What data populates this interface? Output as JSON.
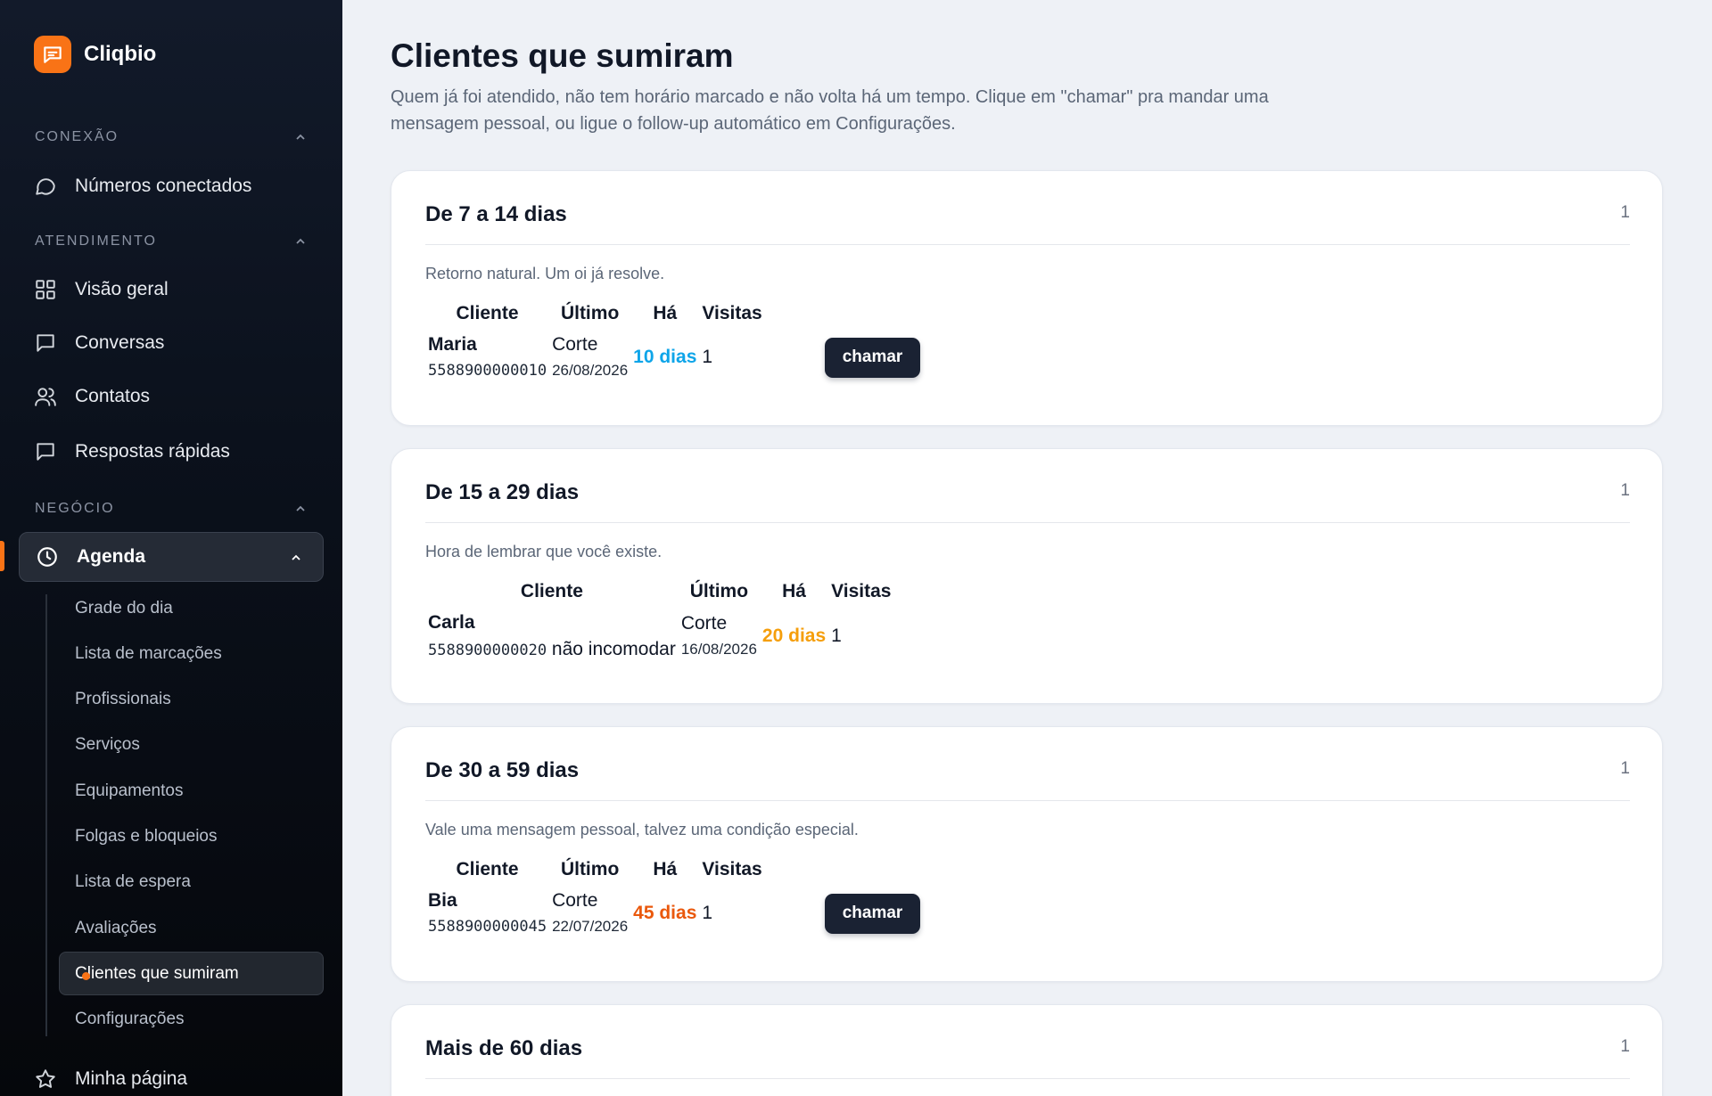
{
  "brand": {
    "name": "Cliqbio"
  },
  "sidebar": {
    "sections": [
      {
        "label": "CONEXÃO"
      },
      {
        "label": "ATENDIMENTO"
      },
      {
        "label": "NEGÓCIO"
      }
    ],
    "conexao_items": [
      {
        "label": "Números conectados",
        "icon": "chat-bubble-icon"
      }
    ],
    "atendimento_items": [
      {
        "label": "Visão geral",
        "icon": "grid-icon"
      },
      {
        "label": "Conversas",
        "icon": "message-square-icon"
      },
      {
        "label": "Contatos",
        "icon": "users-icon"
      },
      {
        "label": "Respostas rápidas",
        "icon": "message-square-icon"
      }
    ],
    "agenda": {
      "label": "Agenda",
      "icon": "clock-icon"
    },
    "agenda_sub": [
      {
        "label": "Grade do dia"
      },
      {
        "label": "Lista de marcações"
      },
      {
        "label": "Profissionais"
      },
      {
        "label": "Serviços"
      },
      {
        "label": "Equipamentos"
      },
      {
        "label": "Folgas e bloqueios"
      },
      {
        "label": "Lista de espera"
      },
      {
        "label": "Avaliações"
      },
      {
        "label": "Clientes que sumiram"
      },
      {
        "label": "Configurações"
      }
    ],
    "minha_pagina": {
      "label": "Minha página",
      "icon": "star-icon"
    }
  },
  "page": {
    "title": "Clientes que sumiram",
    "description": "Quem já foi atendido, não tem horário marcado e não volta há um tempo. Clique em \"chamar\" pra mandar uma mensagem pessoal, ou ligue o follow-up automático em Configurações."
  },
  "table_headers": {
    "cliente": "Cliente",
    "ultimo": "Último",
    "ha": "Há",
    "visitas": "Visitas"
  },
  "groups": [
    {
      "title": "De 7 a 14 dias",
      "count": "1",
      "hint": "Retorno natural. Um oi já resolve.",
      "row": {
        "name": "Maria",
        "phone": "5588900000010",
        "note": "",
        "service": "Corte",
        "date": "26/08/2026",
        "days": "10 dias",
        "days_color": "#0ea5e9",
        "visits": "1",
        "action": "chamar"
      }
    },
    {
      "title": "De 15 a 29 dias",
      "count": "1",
      "hint": "Hora de lembrar que você existe.",
      "row": {
        "name": "Carla",
        "phone": "5588900000020",
        "note": "não incomodar",
        "service": "Corte",
        "date": "16/08/2026",
        "days": "20 dias",
        "days_color": "#f59e0b",
        "visits": "1",
        "action": ""
      }
    },
    {
      "title": "De 30 a 59 dias",
      "count": "1",
      "hint": "Vale uma mensagem pessoal, talvez uma condição especial.",
      "row": {
        "name": "Bia",
        "phone": "5588900000045",
        "note": "",
        "service": "Corte",
        "date": "22/07/2026",
        "days": "45 dias",
        "days_color": "#ea580c",
        "visits": "1",
        "action": "chamar"
      }
    },
    {
      "title": "Mais de 60 dias",
      "count": "1"
    }
  ],
  "colors": {
    "accent": "#f97316",
    "sidebar_bg": "#0b111c",
    "button_bg": "#1a2233"
  }
}
